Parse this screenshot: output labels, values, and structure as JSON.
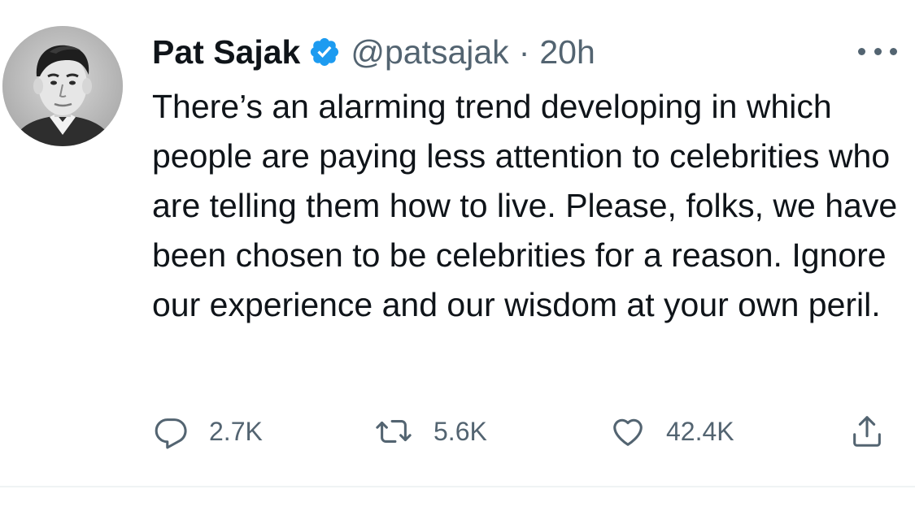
{
  "tweet": {
    "author": {
      "name": "Pat Sajak",
      "handle": "@patsajak",
      "verified": true
    },
    "separator": "·",
    "time": "20h",
    "text": "There’s an alarming trend developing in which people are paying less attention to celebrities who are telling them how to live. Please, folks, we have been chosen to be celebrities for a reason. Ignore our experience and our wisdom at your own peril.",
    "stats": {
      "replies": "2.7K",
      "retweets": "5.6K",
      "likes": "42.4K"
    }
  },
  "icons": {
    "verified": "verified-badge-icon",
    "more": "more-options-icon",
    "reply": "reply-icon",
    "retweet": "retweet-icon",
    "like": "heart-icon",
    "share": "share-icon"
  },
  "colors": {
    "text_primary": "#0f1419",
    "text_secondary": "#536471",
    "verified_blue": "#1d9bf0",
    "divider": "#eff3f4"
  }
}
